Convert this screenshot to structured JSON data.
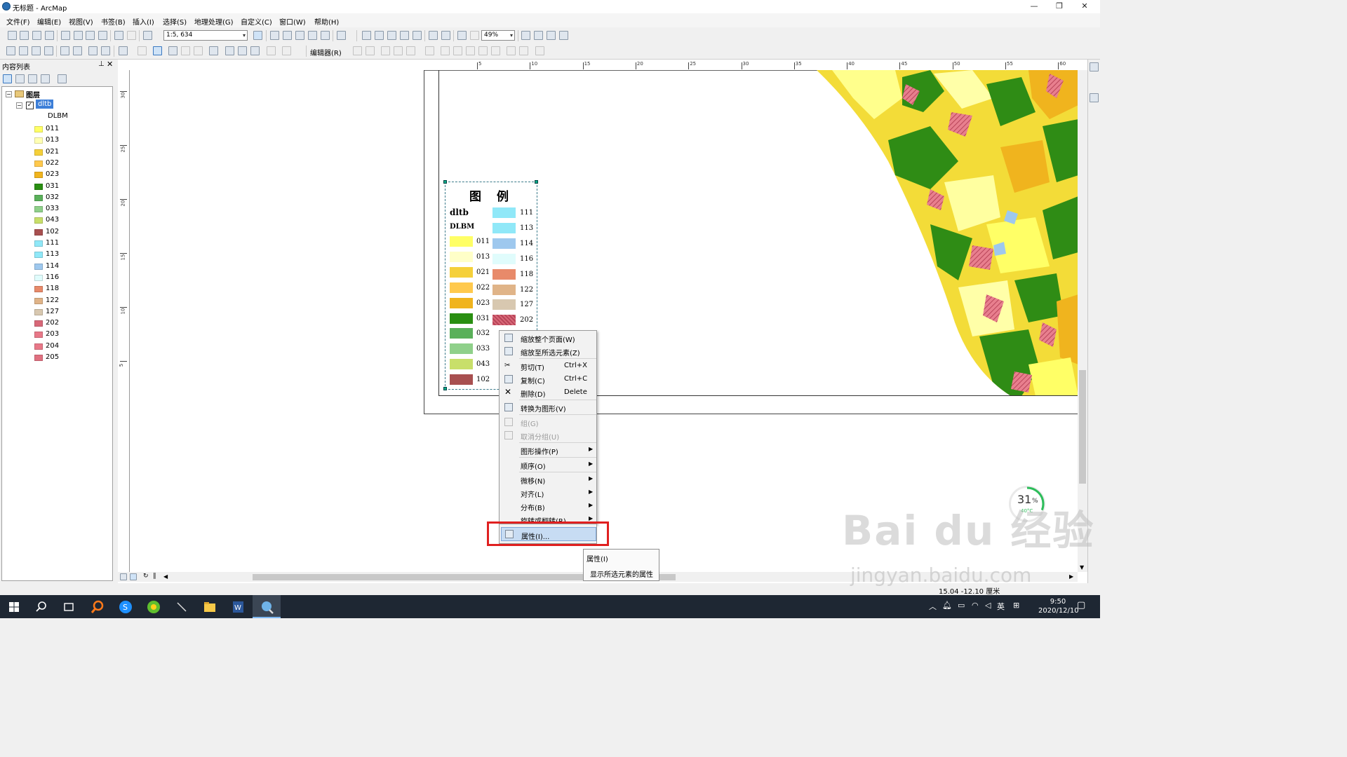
{
  "window": {
    "title": "无标题 - ArcMap",
    "minimize": "—",
    "restore": "❐",
    "close": "✕"
  },
  "menubar": [
    "文件(F)",
    "编辑(E)",
    "视图(V)",
    "书签(B)",
    "插入(I)",
    "选择(S)",
    "地理处理(G)",
    "自定义(C)",
    "窗口(W)",
    "帮助(H)"
  ],
  "toolbar": {
    "scale": "1:5, 634",
    "zoom": "49%",
    "editor": "编辑器(R)"
  },
  "toc": {
    "title": "内容列表",
    "root": "图层",
    "layer": "dltb",
    "field": "DLBM",
    "classes": [
      {
        "code": "011",
        "color": "#ffff66"
      },
      {
        "code": "013",
        "color": "#ffffb3"
      },
      {
        "code": "021",
        "color": "#f5d03a"
      },
      {
        "code": "022",
        "color": "#ffc94d"
      },
      {
        "code": "023",
        "color": "#f0b41e"
      },
      {
        "code": "031",
        "color": "#2a8f12"
      },
      {
        "code": "032",
        "color": "#5ab05a"
      },
      {
        "code": "033",
        "color": "#8fd08a"
      },
      {
        "code": "043",
        "color": "#c8df6a"
      },
      {
        "code": "102",
        "color": "#a85050"
      },
      {
        "code": "111",
        "color": "#90e8f8"
      },
      {
        "code": "113",
        "color": "#90e8f8"
      },
      {
        "code": "114",
        "color": "#9ec8ee"
      },
      {
        "code": "116",
        "color": "#e0fcfc"
      },
      {
        "code": "118",
        "color": "#e88a6a"
      },
      {
        "code": "122",
        "color": "#e0b488"
      },
      {
        "code": "127",
        "color": "#d8c8b0"
      },
      {
        "code": "202",
        "color": "#d86878"
      },
      {
        "code": "203",
        "color": "#e87888"
      },
      {
        "code": "204",
        "color": "#e87888"
      },
      {
        "code": "205",
        "color": "#e07080"
      }
    ]
  },
  "ruler": {
    "h": [
      "5",
      "10",
      "15",
      "20",
      "25",
      "30",
      "35",
      "40",
      "45",
      "50",
      "55",
      "60"
    ],
    "v": [
      "30",
      "25",
      "20",
      "15",
      "10",
      "5"
    ]
  },
  "legend": {
    "title": "图 例",
    "layer": "dltb",
    "field": "DLBM",
    "left": [
      {
        "code": "011",
        "color": "#ffff66"
      },
      {
        "code": "013",
        "color": "#ffffc8"
      },
      {
        "code": "021",
        "color": "#f5d03a"
      },
      {
        "code": "022",
        "color": "#ffc94d"
      },
      {
        "code": "023",
        "color": "#f0b41e"
      },
      {
        "code": "031",
        "color": "#2a8f12"
      },
      {
        "code": "032",
        "color": "#5ab05a"
      },
      {
        "code": "033",
        "color": "#8fd08a"
      },
      {
        "code": "043",
        "color": "#c8df6a"
      },
      {
        "code": "102",
        "color": "#a85050"
      }
    ],
    "right": [
      {
        "code": "111",
        "color": "#90e8f8"
      },
      {
        "code": "113",
        "color": "#90e8f8"
      },
      {
        "code": "114",
        "color": "#9ec8ee"
      },
      {
        "code": "116",
        "color": "#e0fcfc"
      },
      {
        "code": "118",
        "color": "#e88a6a"
      },
      {
        "code": "122",
        "color": "#e0b488"
      },
      {
        "code": "127",
        "color": "#d8c8b0"
      },
      {
        "code": "202",
        "color": "#d86878"
      }
    ]
  },
  "context_menu": {
    "items": [
      {
        "label": "缩放整个页面(W)",
        "shortcut": "",
        "submenu": false,
        "disabled": false
      },
      {
        "label": "缩放至所选元素(Z)",
        "shortcut": "",
        "submenu": false,
        "disabled": false
      },
      {
        "label": "剪切(T)",
        "shortcut": "Ctrl+X",
        "submenu": false,
        "disabled": false
      },
      {
        "label": "复制(C)",
        "shortcut": "Ctrl+C",
        "submenu": false,
        "disabled": false
      },
      {
        "label": "删除(D)",
        "shortcut": "Delete",
        "submenu": false,
        "disabled": false
      },
      {
        "label": "转换为图形(V)",
        "shortcut": "",
        "submenu": false,
        "disabled": false
      },
      {
        "label": "组(G)",
        "shortcut": "",
        "submenu": false,
        "disabled": true
      },
      {
        "label": "取消分组(U)",
        "shortcut": "",
        "submenu": false,
        "disabled": true
      },
      {
        "label": "图形操作(P)",
        "shortcut": "",
        "submenu": true,
        "disabled": false
      },
      {
        "label": "顺序(O)",
        "shortcut": "",
        "submenu": true,
        "disabled": false
      },
      {
        "label": "微移(N)",
        "shortcut": "",
        "submenu": true,
        "disabled": false
      },
      {
        "label": "对齐(L)",
        "shortcut": "",
        "submenu": true,
        "disabled": false
      },
      {
        "label": "分布(B)",
        "shortcut": "",
        "submenu": true,
        "disabled": false
      },
      {
        "label": "旋转或翻转(R)",
        "shortcut": "",
        "submenu": true,
        "disabled": false
      }
    ],
    "properties": "属性(I)..."
  },
  "tooltip": {
    "title": "属性(I)",
    "desc": "显示所选元素的属性"
  },
  "status": "15.04  -12.10 厘米",
  "widget": {
    "value": "31",
    "unit": "%",
    "temp": "40°C"
  },
  "watermark": {
    "main": "Bai du 经验",
    "sub": "jingyan.baidu.com"
  },
  "taskbar": {
    "time": "9:50",
    "date": "2020/12/10",
    "ime": "英"
  }
}
